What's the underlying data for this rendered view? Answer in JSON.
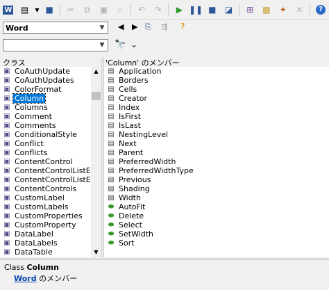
{
  "toolbar": {
    "buttons": [
      "word-icon",
      "view-object-icon",
      "dropdown-arrow-icon",
      "save-icon",
      "cut-icon",
      "copy-icon",
      "paste-icon",
      "find-icon",
      "undo-icon",
      "redo-icon",
      "run-icon",
      "pause-icon",
      "stop-icon",
      "design-mode-icon",
      "project-explorer-icon",
      "properties-icon",
      "object-browser-icon",
      "toolbox-icon",
      "help-icon"
    ]
  },
  "library": {
    "value": "Word"
  },
  "search": {
    "value": ""
  },
  "classes": {
    "header": "クラス",
    "items": [
      "CoAuthUpdate",
      "CoAuthUpdates",
      "ColorFormat",
      "Column",
      "Columns",
      "Comment",
      "Comments",
      "ConditionalStyle",
      "Conflict",
      "Conflicts",
      "ContentControl",
      "ContentControlListEnt",
      "ContentControlListEnt",
      "ContentControls",
      "CustomLabel",
      "CustomLabels",
      "CustomProperties",
      "CustomProperty",
      "DataLabel",
      "DataLabels",
      "DataTable"
    ],
    "selected_index": 3
  },
  "members": {
    "header": "'Column' のメンバー",
    "properties": [
      "Application",
      "Borders",
      "Cells",
      "Creator",
      "Index",
      "IsFirst",
      "IsLast",
      "NestingLevel",
      "Next",
      "Parent",
      "PreferredWidth",
      "PreferredWidthType",
      "Previous",
      "Shading",
      "Width"
    ],
    "methods": [
      "AutoFit",
      "Delete",
      "Select",
      "SetWidth",
      "Sort"
    ]
  },
  "status": {
    "kind": "Class",
    "name": "Column",
    "library_link": "Word",
    "member_of": "のメンバー"
  },
  "colors": {
    "selection": "#0078d7",
    "link": "#0645ad",
    "method_icon": "#3a9a2a"
  }
}
